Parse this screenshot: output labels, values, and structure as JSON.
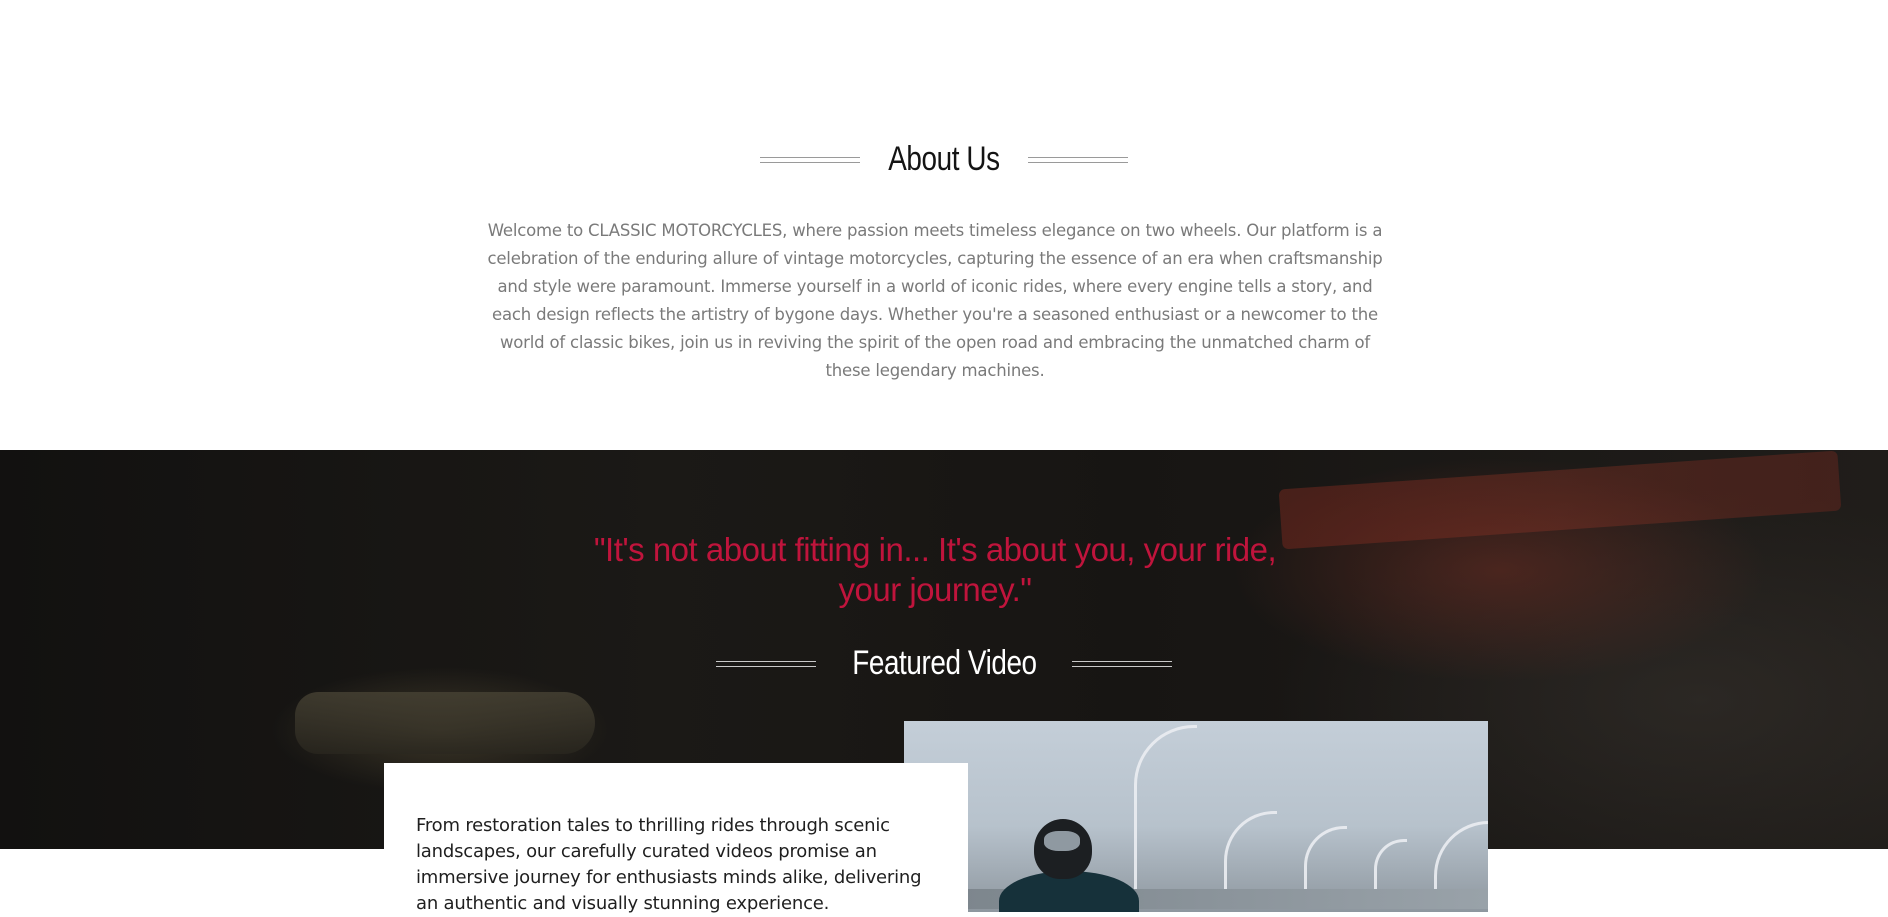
{
  "about": {
    "title": "About Us",
    "body": "Welcome to CLASSIC MOTORCYCLES, where passion meets timeless elegance on two wheels. Our platform is a celebration of the enduring allure of vintage motorcycles, capturing the essence of an era when craftsmanship and style were paramount. Immerse yourself in a world of iconic rides, where every engine tells a story, and each design reflects the artistry of bygone days. Whether you're a seasoned enthusiast or a newcomer to the world of classic bikes, join us in reviving the spirit of the open road and embracing the unmatched charm of these legendary machines."
  },
  "featured": {
    "quote": "\"It's not about fitting in... It's about you, your ride, your journey.\"",
    "title": "Featured Video",
    "description": "From restoration tales to thrilling rides through scenic landscapes, our carefully curated videos promise an immersive journey for enthusiasts minds alike, delivering an authentic and visually stunning experience."
  },
  "colors": {
    "quote_accent": "#c0143c",
    "body_text": "#7a7a7a",
    "dark_band": "#171513"
  }
}
